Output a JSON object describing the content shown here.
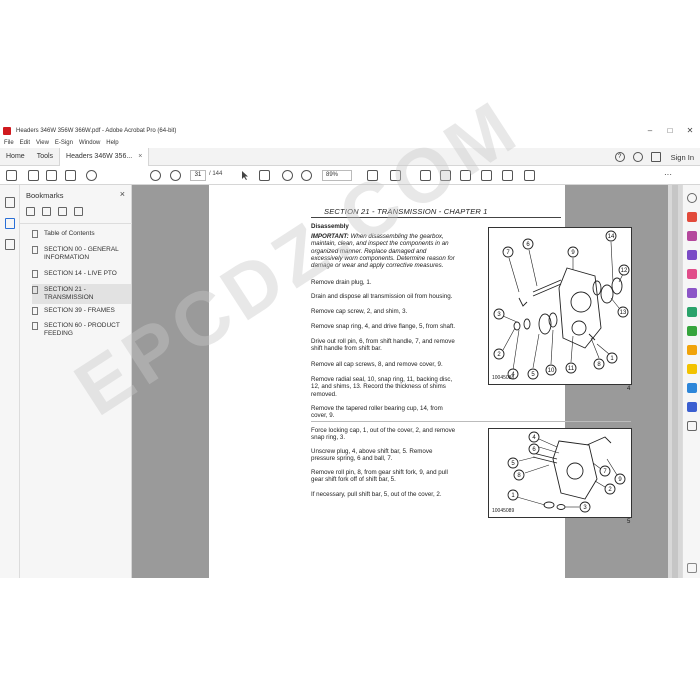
{
  "window": {
    "title": "Headers 346W 356W 366W.pdf - Adobe Acrobat Pro (64-bit)"
  },
  "menu": [
    "File",
    "Edit",
    "View",
    "E-Sign",
    "Window",
    "Help"
  ],
  "tabs": {
    "home": "Home",
    "tools": "Tools",
    "document": "Headers 346W 356...",
    "close_glyph": "×",
    "sign_in": "Sign In"
  },
  "toolbar": {
    "current_page": "31",
    "page_total": "/ 144",
    "zoom": "89%"
  },
  "bookmarks": {
    "title": "Bookmarks",
    "close_glyph": "×",
    "items": [
      {
        "label": "Table of Contents"
      },
      {
        "label": "SECTION 00 - GENERAL INFORMATION"
      },
      {
        "label": "SECTION 14 - LIVE PTO"
      },
      {
        "label": "SECTION 21 - TRANSMISSION",
        "selected": true
      },
      {
        "label": "SECTION 39 - FRAMES"
      },
      {
        "label": "SECTION 60 - PRODUCT FEEDING"
      }
    ]
  },
  "document": {
    "section_header": "SECTION 21 - TRANSMISSION - CHAPTER 1",
    "heading": "Disassembly",
    "important_label": "IMPORTANT:",
    "important_text": " When disassembling the gearbox, maintain, clean, and inspect the components in an organized manner. Replace damaged and excessively worn components. Determine reason for damage or wear and apply corrective measures.",
    "steps_a": [
      "Remove drain plug, 1.",
      "Drain and dispose all transmission oil from housing.",
      "Remove cap screw, 2, and shim, 3.",
      "Remove snap ring, 4, and drive flange, 5, from shaft.",
      "Drive out roll pin, 6, from shift handle, 7, and remove shift handle from shift bar.",
      "Remove all cap screws, 8, and remove cover, 9.",
      "Remove radial seal, 10, snap ring, 11, backing disc, 12, and shims, 13. Record the thickness of shims removed.",
      "Remove the tapered roller bearing cup, 14, from cover, 9."
    ],
    "steps_b": [
      "Force locking cap, 1, out of the cover, 2, and remove snap ring, 3.",
      "Unscrew plug, 4, above shift bar, 5. Remove pressure spring, 6 and ball, 7.",
      "Remove roll pin, 8, from gear shift fork, 9, and pull gear shift fork off of shift bar, 5.",
      "If necessary, pull shift bar, 5, out of the cover, 2."
    ],
    "figure1": {
      "id": "10045088",
      "page_label": "4",
      "callouts": [
        "1",
        "2",
        "3",
        "4",
        "5",
        "6",
        "7",
        "8",
        "9",
        "10",
        "11",
        "12",
        "13",
        "14"
      ]
    },
    "figure2": {
      "id": "10045089",
      "page_label": "5",
      "callouts": [
        "1",
        "2",
        "3",
        "4",
        "5",
        "6",
        "7",
        "8",
        "9"
      ]
    }
  },
  "watermark": "EPCDZ.COM"
}
